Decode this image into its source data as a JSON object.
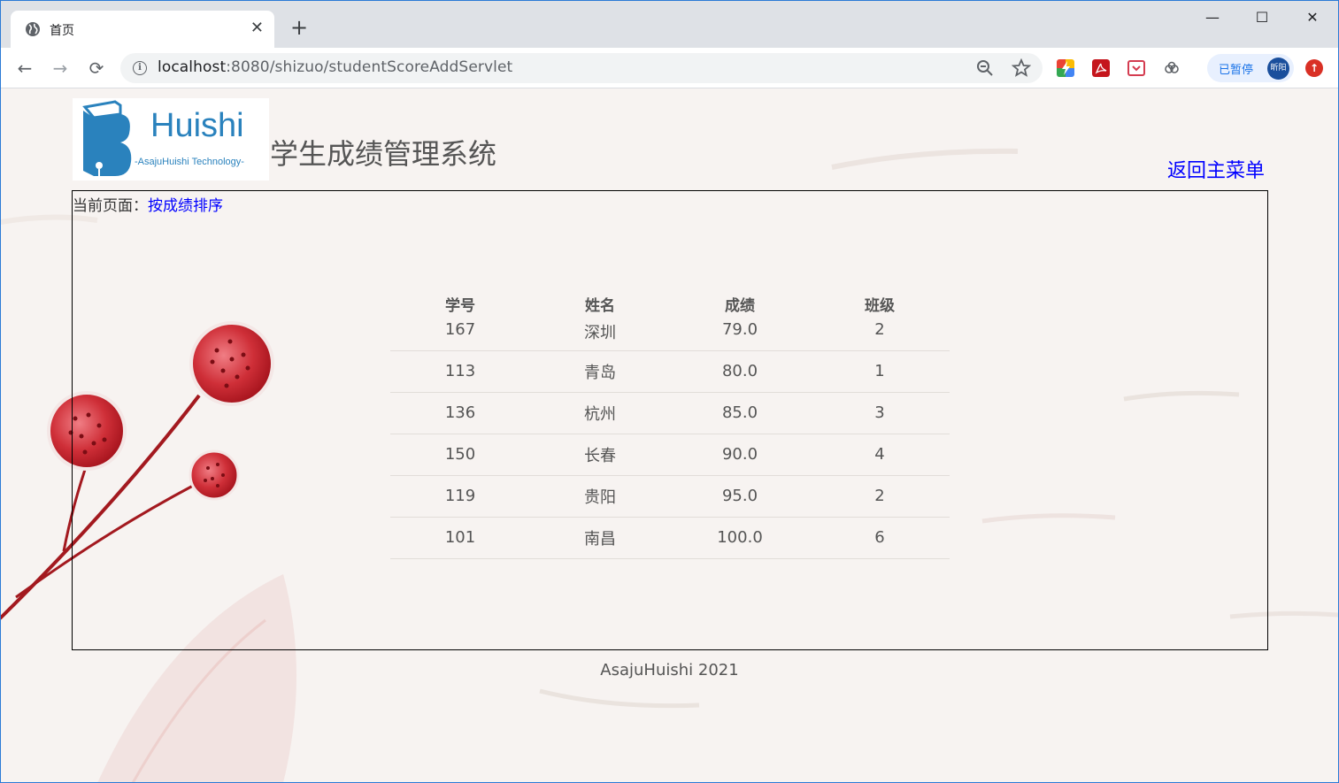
{
  "browser": {
    "tab_title": "首页",
    "url_host": "localhost",
    "url_rest": ":8080/shizuo/studentScoreAddServlet",
    "profile_label": "已暂停",
    "profile_avatar_text": "昕阳"
  },
  "header": {
    "logo_text": "Huishi",
    "logo_subtext": "-AsajuHuishi Technology-",
    "site_title": "学生成绩管理系统",
    "back_link": "返回主菜单"
  },
  "breadcrumb": {
    "prefix": "当前页面：",
    "current": "按成绩排序"
  },
  "table": {
    "headers": [
      "学号",
      "姓名",
      "成绩",
      "班级"
    ],
    "rows": [
      [
        "167",
        "深圳",
        "79.0",
        "2"
      ],
      [
        "113",
        "青岛",
        "80.0",
        "1"
      ],
      [
        "136",
        "杭州",
        "85.0",
        "3"
      ],
      [
        "150",
        "长春",
        "90.0",
        "4"
      ],
      [
        "119",
        "贵阳",
        "95.0",
        "2"
      ],
      [
        "101",
        "南昌",
        "100.0",
        "6"
      ]
    ]
  },
  "footer": {
    "text": "AsajuHuishi 2021"
  },
  "colors": {
    "link": "#0000ff",
    "logo_blue": "#2a82bd",
    "flower_red": "#c8252e"
  }
}
